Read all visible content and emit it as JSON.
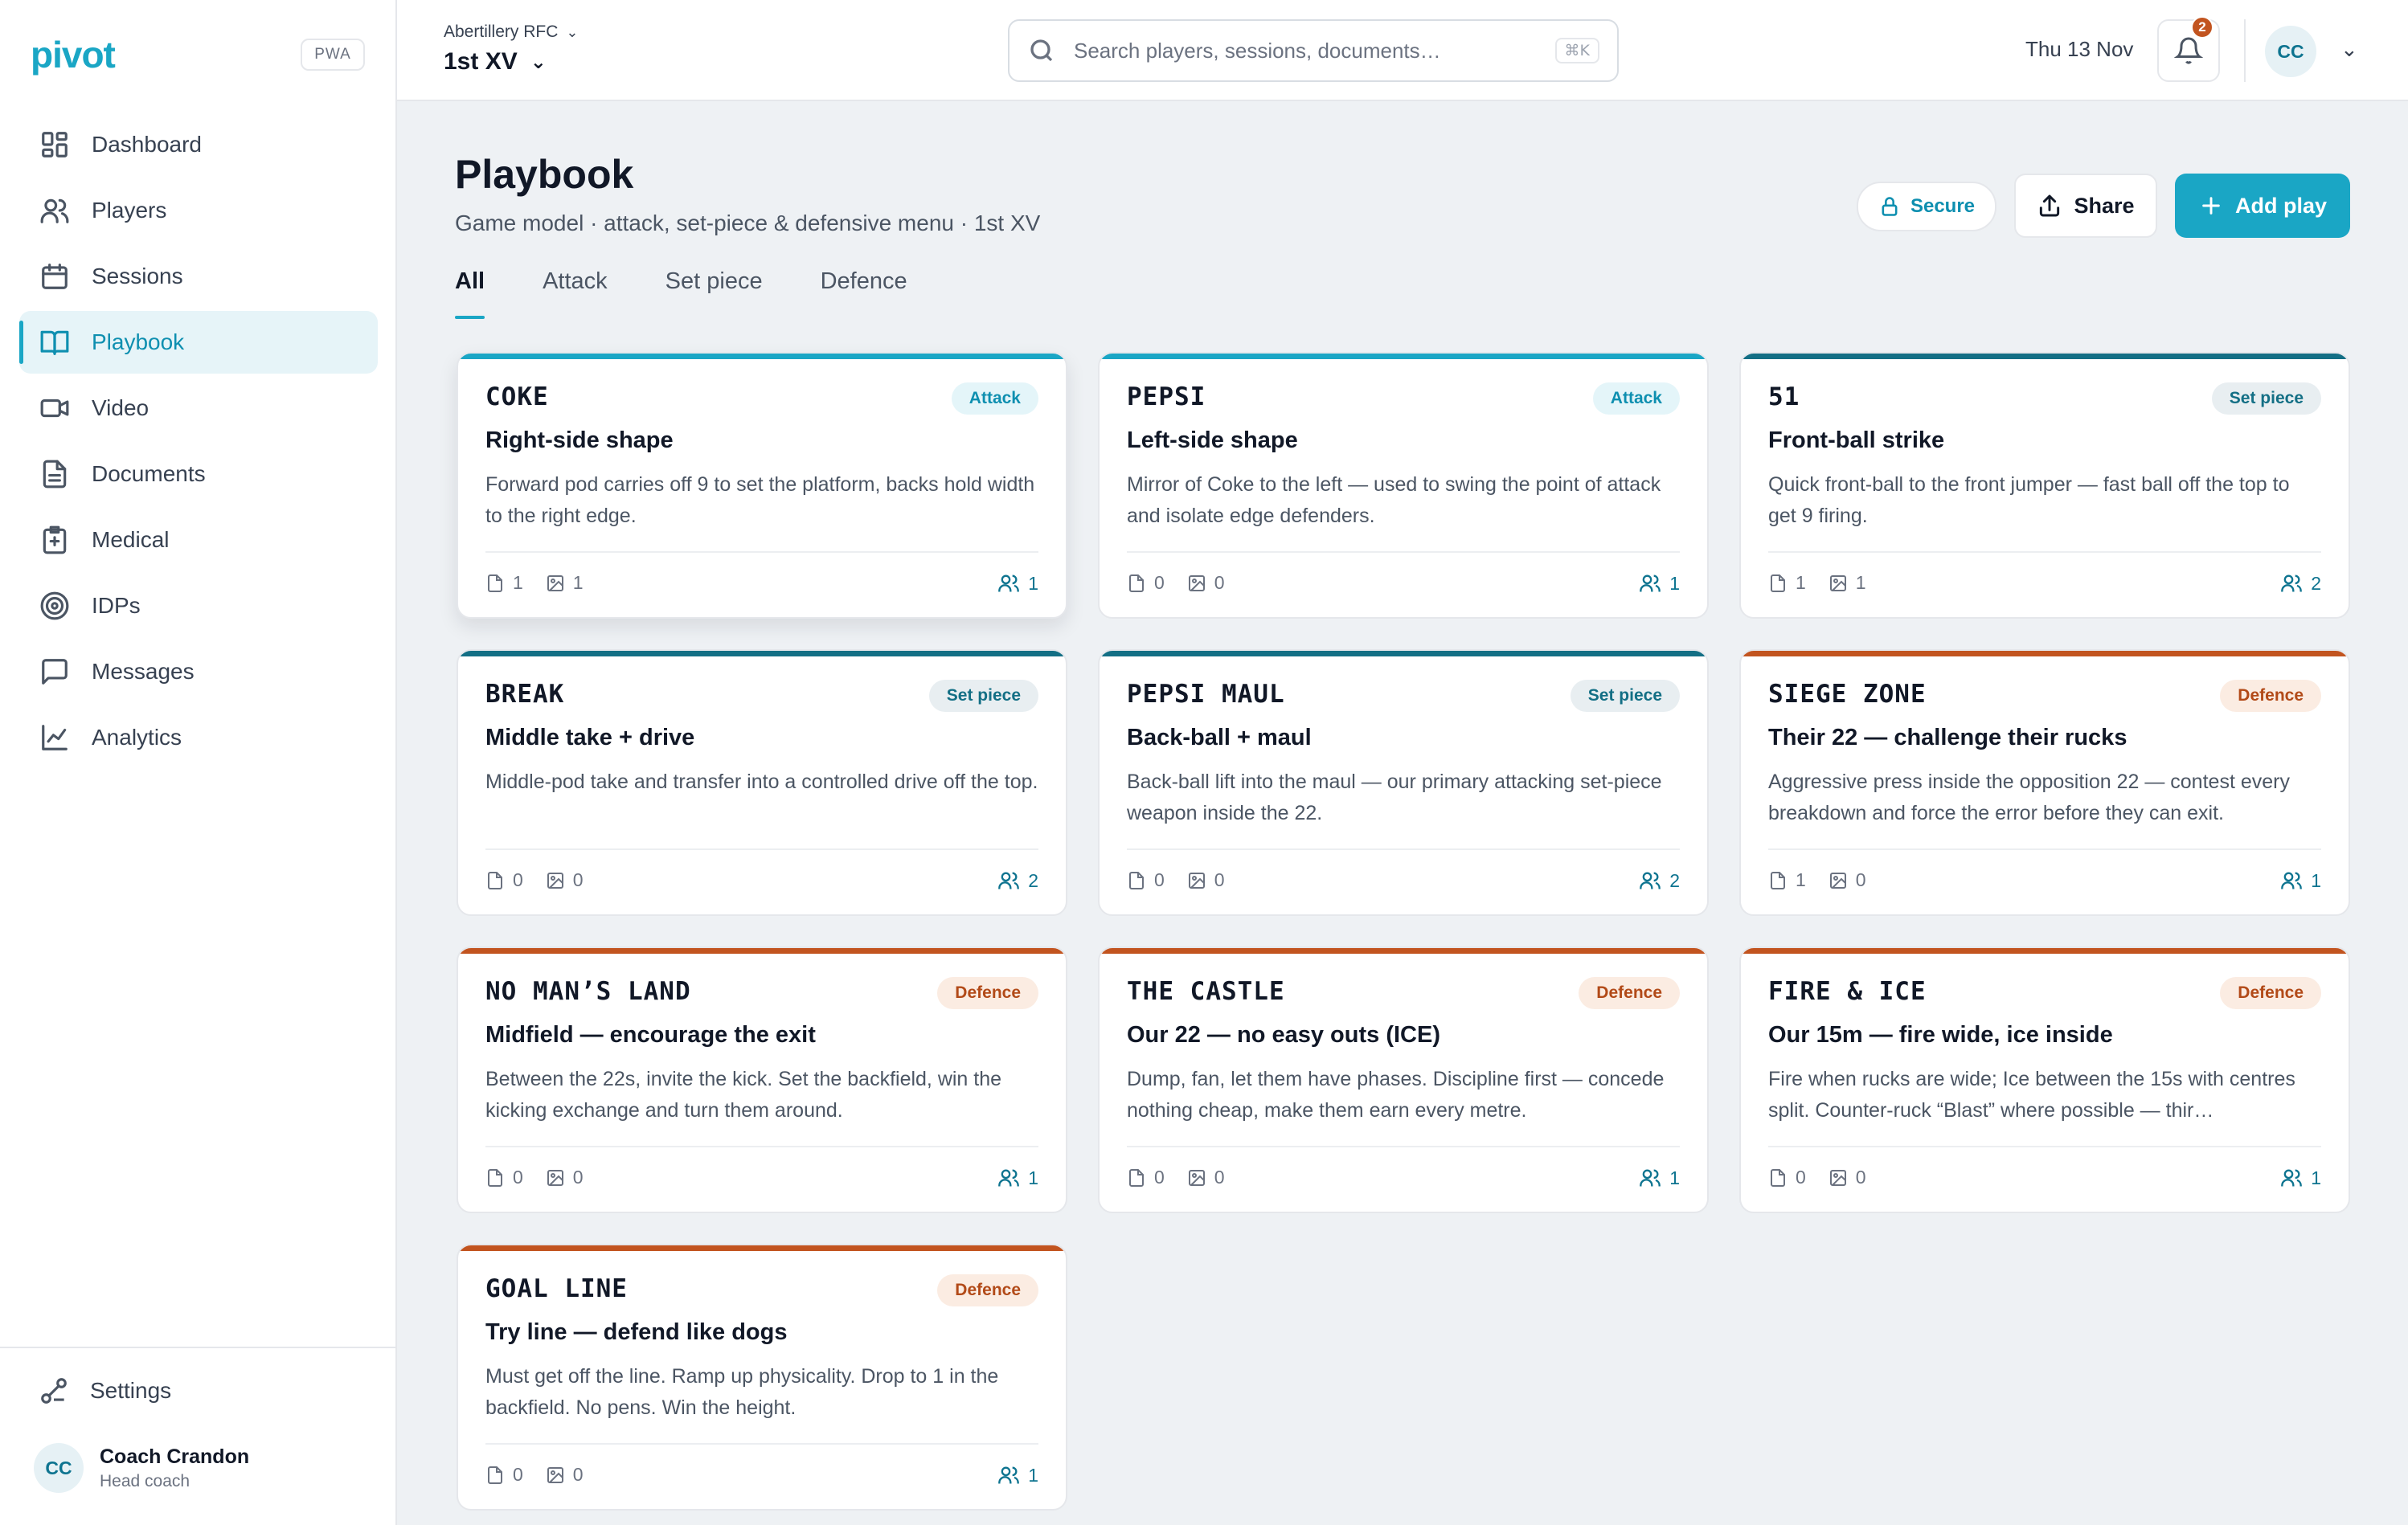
{
  "brand": {
    "name": "pivot",
    "badge": "PWA"
  },
  "sidebar": {
    "items": [
      {
        "label": "Dashboard",
        "icon": "grid-icon"
      },
      {
        "label": "Players",
        "icon": "users-icon"
      },
      {
        "label": "Sessions",
        "icon": "calendar-icon"
      },
      {
        "label": "Playbook",
        "icon": "book-icon",
        "active": true
      },
      {
        "label": "Video",
        "icon": "video-icon"
      },
      {
        "label": "Documents",
        "icon": "document-icon"
      },
      {
        "label": "Medical",
        "icon": "medical-icon"
      },
      {
        "label": "IDPs",
        "icon": "target-icon"
      },
      {
        "label": "Messages",
        "icon": "message-icon"
      },
      {
        "label": "Analytics",
        "icon": "chart-icon"
      }
    ],
    "settings": "Settings",
    "user": {
      "initials": "CC",
      "name": "Coach Crandon",
      "role": "Head coach"
    }
  },
  "topbar": {
    "club": "Abertillery RFC",
    "squad": "1st XV",
    "search_placeholder": "Search players, sessions, documents…",
    "search_shortcut": "⌘K",
    "date": "Thu 13 Nov",
    "notifications": "2",
    "user_initials": "CC"
  },
  "page": {
    "title": "Playbook",
    "subtitle": "Game model · attack, set-piece & defensive menu · 1st XV",
    "tabs": [
      "All",
      "Attack",
      "Set piece",
      "Defence"
    ],
    "active_tab": "All",
    "secure_label": "Secure",
    "share_label": "Share",
    "add_label": "Add play"
  },
  "colors": {
    "accent": "#1aa6c5",
    "attack_strip": "#1aa6c5",
    "setpiece_strip": "#136f85",
    "defence_strip": "#c2541f",
    "attack_badge_bg": "#e4f5f9",
    "attack_badge_fg": "#0e8fb0",
    "setpiece_badge_bg": "#e8eef1",
    "setpiece_badge_fg": "#136f85",
    "defence_badge_bg": "#fbece2",
    "defence_badge_fg": "#b24a18"
  },
  "plays": [
    {
      "code": "COKE",
      "category": "Attack",
      "title": "Right-side shape",
      "description": "Forward pod carries off 9 to set the platform, backs hold width to the right edge.",
      "docs": "1",
      "images": "1",
      "people": "1"
    },
    {
      "code": "PEPSI",
      "category": "Attack",
      "title": "Left-side shape",
      "description": "Mirror of Coke to the left — used to swing the point of attack and isolate edge defenders.",
      "docs": "0",
      "images": "0",
      "people": "1"
    },
    {
      "code": "51",
      "category": "Set piece",
      "title": "Front-ball strike",
      "description": "Quick front-ball to the front jumper — fast ball off the top to get 9 firing.",
      "docs": "1",
      "images": "1",
      "people": "2"
    },
    {
      "code": "BREAK",
      "category": "Set piece",
      "title": "Middle take + drive",
      "description": "Middle-pod take and transfer into a controlled drive off the top.",
      "docs": "0",
      "images": "0",
      "people": "2"
    },
    {
      "code": "PEPSI MAUL",
      "category": "Set piece",
      "title": "Back-ball + maul",
      "description": "Back-ball lift into the maul — our primary attacking set-piece weapon inside the 22.",
      "docs": "0",
      "images": "0",
      "people": "2"
    },
    {
      "code": "SIEGE ZONE",
      "category": "Defence",
      "title": "Their 22 — challenge their rucks",
      "description": "Aggressive press inside the opposition 22 — contest every breakdown and force the error before they can exit.",
      "docs": "1",
      "images": "0",
      "people": "1"
    },
    {
      "code": "NO MAN’S LAND",
      "category": "Defence",
      "title": "Midfield — encourage the exit",
      "description": "Between the 22s, invite the kick. Set the backfield, win the kicking exchange and turn them around.",
      "docs": "0",
      "images": "0",
      "people": "1"
    },
    {
      "code": "THE CASTLE",
      "category": "Defence",
      "title": "Our 22 — no easy outs (ICE)",
      "description": "Dump, fan, let them have phases. Discipline first — concede nothing cheap, make them earn every metre.",
      "docs": "0",
      "images": "0",
      "people": "1"
    },
    {
      "code": "FIRE & ICE",
      "category": "Defence",
      "title": "Our 15m — fire wide, ice inside",
      "description": "Fire when rucks are wide; Ice between the 15s with centres split. Counter-ruck “Blast” where possible — thir…",
      "docs": "0",
      "images": "0",
      "people": "1"
    },
    {
      "code": "GOAL LINE",
      "category": "Defence",
      "title": "Try line — defend like dogs",
      "description": "Must get off the line. Ramp up physicality. Drop to 1 in the backfield. No pens. Win the height.",
      "docs": "0",
      "images": "0",
      "people": "1"
    }
  ]
}
